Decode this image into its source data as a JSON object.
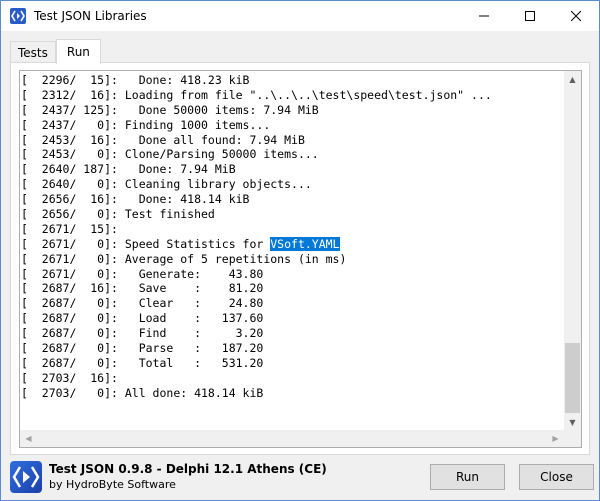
{
  "window": {
    "title": "Test JSON Libraries"
  },
  "tabs": [
    {
      "label": "Tests"
    },
    {
      "label": "Run"
    }
  ],
  "log": {
    "lines": [
      "[  2296/  15]:   Done: 418.23 kiB",
      "[  2312/  16]: Loading from file \"..\\..\\..\\test\\speed\\test.json\" ...",
      "[  2437/ 125]:   Done 50000 items: 7.94 MiB",
      "[  2437/   0]: Finding 1000 items...",
      "[  2453/  16]:   Done all found: 7.94 MiB",
      "[  2453/   0]: Clone/Parsing 50000 items...",
      "[  2640/ 187]:   Done: 7.94 MiB",
      "[  2640/   0]: Cleaning library objects...",
      "[  2656/  16]:   Done: 418.14 kiB",
      "[  2656/   0]: Test finished",
      "[  2671/  15]:",
      "[  2671/   0]: Speed Statistics for ",
      "[  2671/   0]: Average of 5 repetitions (in ms)",
      "[  2671/   0]:   Generate:    43.80",
      "[  2687/  16]:   Save    :    81.20",
      "[  2687/   0]:   Clear   :    24.80",
      "[  2687/   0]:   Load    :   137.60",
      "[  2687/   0]:   Find    :     3.20",
      "[  2687/   0]:   Parse   :   187.20",
      "[  2687/   0]:   Total   :   531.20",
      "[  2703/  16]:",
      "[  2703/   0]: All done: 418.14 kiB"
    ],
    "selected_text": "VSoft.YAML"
  },
  "footer": {
    "app_title": "Test JSON 0.9.8 - Delphi 12.1 Athens (CE)",
    "app_subtitle": "by HydroByte Software",
    "run_label": "Run",
    "close_label": "Close"
  },
  "colors": {
    "selection": "#0078d7",
    "icon": "#2a5cc8"
  }
}
